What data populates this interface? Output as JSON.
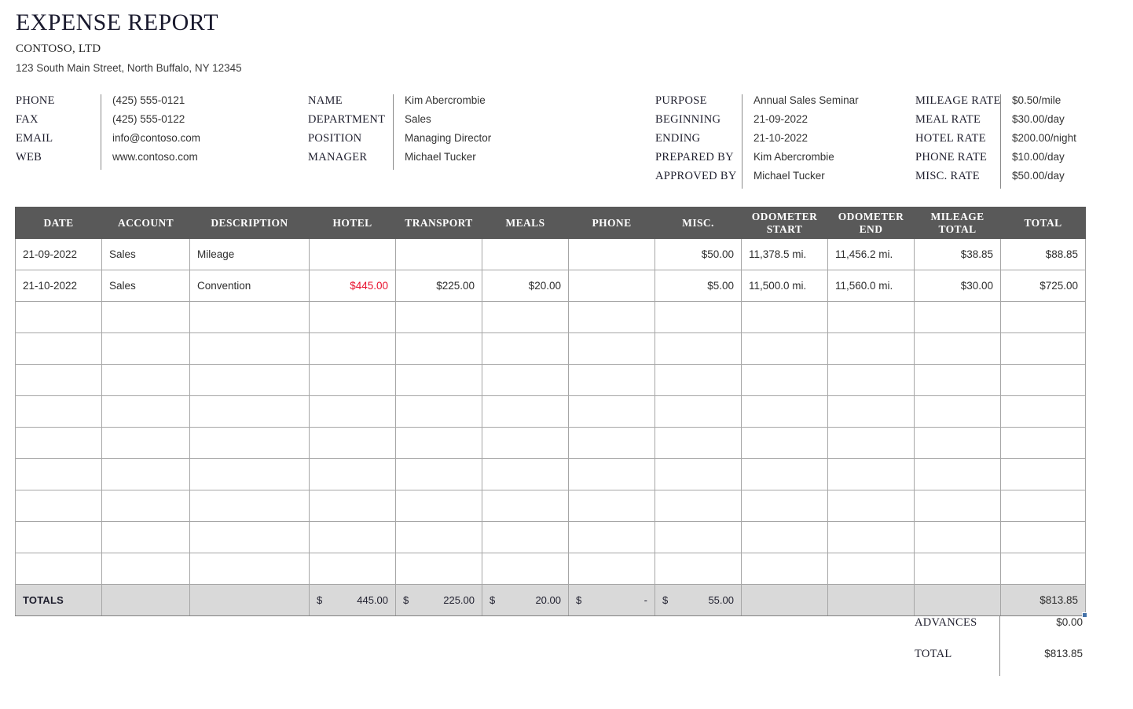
{
  "masthead": {
    "title": "EXPENSE REPORT",
    "company": "CONTOSO, LTD",
    "address": "123 South Main Street, North Buffalo, NY 12345"
  },
  "info": {
    "contact": [
      {
        "label": "PHONE",
        "value": "(425) 555-0121"
      },
      {
        "label": "FAX",
        "value": "(425) 555-0122"
      },
      {
        "label": "EMAIL",
        "value": "info@contoso.com"
      },
      {
        "label": "WEB",
        "value": "www.contoso.com"
      }
    ],
    "employee": [
      {
        "label": "NAME",
        "value": "Kim Abercrombie"
      },
      {
        "label": "DEPARTMENT",
        "value": "Sales"
      },
      {
        "label": "POSITION",
        "value": "Managing Director"
      },
      {
        "label": "MANAGER",
        "value": "Michael Tucker"
      }
    ],
    "trip": [
      {
        "label": "PURPOSE",
        "value": "Annual Sales Seminar"
      },
      {
        "label": "BEGINNING",
        "value": "21-09-2022"
      },
      {
        "label": "ENDING",
        "value": "21-10-2022"
      },
      {
        "label": "PREPARED BY",
        "value": "Kim Abercrombie"
      },
      {
        "label": "APPROVED BY",
        "value": "Michael Tucker"
      }
    ],
    "rates": [
      {
        "label": "MILEAGE RATE",
        "value": "$0.50/mile"
      },
      {
        "label": "MEAL RATE",
        "value": "$30.00/day"
      },
      {
        "label": "HOTEL RATE",
        "value": "$200.00/night"
      },
      {
        "label": "PHONE RATE",
        "value": "$10.00/day"
      },
      {
        "label": "MISC. RATE",
        "value": "$50.00/day"
      }
    ]
  },
  "table": {
    "columns": [
      "DATE",
      "ACCOUNT",
      "DESCRIPTION",
      "HOTEL",
      "TRANSPORT",
      "MEALS",
      "PHONE",
      "MISC.",
      "ODOMETER START",
      "ODOMETER END",
      "MILEAGE TOTAL",
      "TOTAL"
    ],
    "rows": [
      {
        "date": "21-09-2022",
        "account": "Sales",
        "description": "Mileage",
        "hotel": "",
        "transport": "",
        "meals": "",
        "phone": "",
        "misc": "$50.00",
        "odometer_start": "11,378.5 mi.",
        "odometer_end": "11,456.2 mi.",
        "mileage_total": "$38.85",
        "total": "$88.85",
        "hotel_is_red": false
      },
      {
        "date": "21-10-2022",
        "account": "Sales",
        "description": "Convention",
        "hotel": "$445.00",
        "transport": "$225.00",
        "meals": "$20.00",
        "phone": "",
        "misc": "$5.00",
        "odometer_start": "11,500.0 mi.",
        "odometer_end": "11,560.0 mi.",
        "mileage_total": "$30.00",
        "total": "$725.00",
        "hotel_is_red": true
      }
    ],
    "empty_row_count": 9,
    "totals": {
      "label": "TOTALS",
      "hotel_symbol": "$",
      "hotel_amount": "445.00",
      "transport_symbol": "$",
      "transport_amount": "225.00",
      "meals_symbol": "$",
      "meals_amount": "20.00",
      "phone_symbol": "$",
      "phone_amount": "-",
      "misc_symbol": "$",
      "misc_amount": "55.00",
      "grand_total": "$813.85"
    }
  },
  "summary": [
    {
      "label": "ADVANCES",
      "value": "$0.00"
    },
    {
      "label": "TOTAL",
      "value": "$813.85"
    }
  ],
  "colors": {
    "header_fill": "#595959",
    "totals_fill": "#d9d9d9",
    "grid_line": "#a6a6a6",
    "red_value": "#e8112d",
    "selection_handle": "#4472a8"
  }
}
